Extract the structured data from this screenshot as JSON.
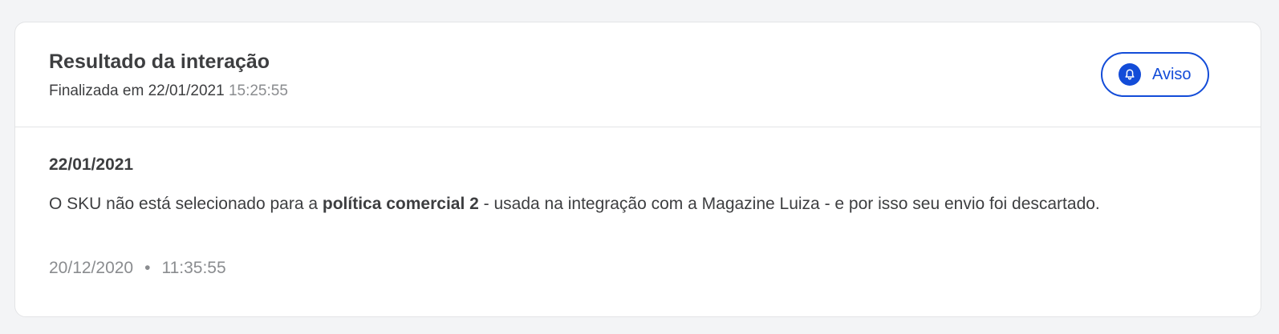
{
  "header": {
    "title": "Resultado da interação",
    "finalized_prefix": "Finalizada em",
    "finalized_date": "22/01/2021",
    "finalized_time": "15:25:55",
    "notice_button": {
      "label": "Aviso",
      "icon": "bell-icon"
    }
  },
  "entry": {
    "date": "22/01/2021",
    "message_before": "O SKU não está selecionado para a ",
    "message_bold": "política comercial 2",
    "message_after": " - usada na integração com a Magazine Luiza - e por isso seu envio foi descartado.",
    "meta_date": "20/12/2020",
    "meta_separator": "•",
    "meta_time": "11:35:55"
  },
  "colors": {
    "accent": "#134cd8",
    "text": "#3d3e40",
    "muted": "#8a8c8f",
    "background": "#f3f4f6",
    "border": "#e3e4e6"
  }
}
